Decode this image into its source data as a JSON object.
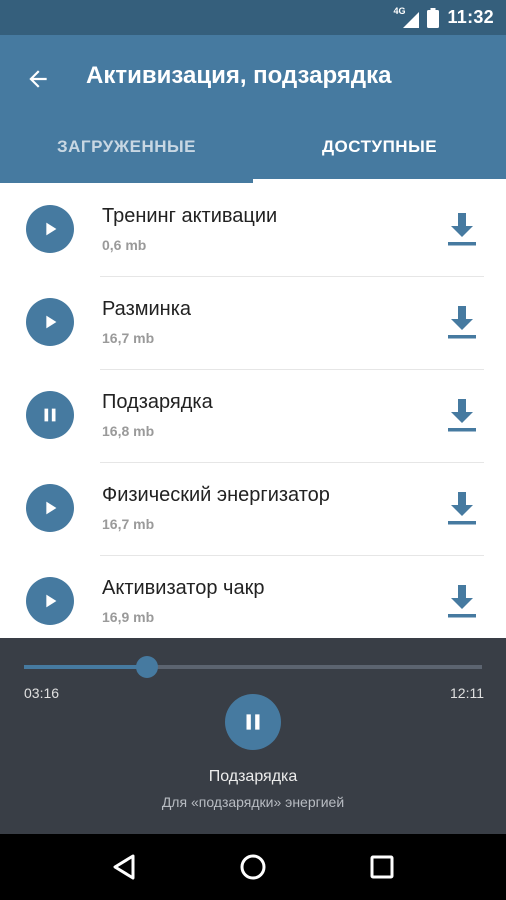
{
  "status_bar": {
    "network": "4G",
    "time": "11:32"
  },
  "app_bar": {
    "title": "Активизация, подзарядка",
    "back_icon": "arrow-back-icon",
    "tabs": [
      {
        "label": "ЗАГРУЖЕННЫЕ",
        "active": false
      },
      {
        "label": "ДОСТУПНЫЕ",
        "active": true
      }
    ]
  },
  "tracks": [
    {
      "title": "Тренинг активации",
      "size": "0,6 mb",
      "state": "play"
    },
    {
      "title": "Разминка",
      "size": "16,7 mb",
      "state": "play"
    },
    {
      "title": "Подзарядка",
      "size": "16,8 mb",
      "state": "pause"
    },
    {
      "title": "Физический энергизатор",
      "size": "16,7 mb",
      "state": "play"
    },
    {
      "title": "Активизатор чакр",
      "size": "16,9 mb",
      "state": "play"
    }
  ],
  "player": {
    "current_time": "03:16",
    "total_time": "12:11",
    "progress_fraction": 0.268,
    "title": "Подзарядка",
    "subtitle": "Для «подзарядки» энергией",
    "state": "pause"
  },
  "colors": {
    "primary": "#467aa0",
    "status_bar": "#355f7c",
    "player_bg": "#393e46"
  }
}
